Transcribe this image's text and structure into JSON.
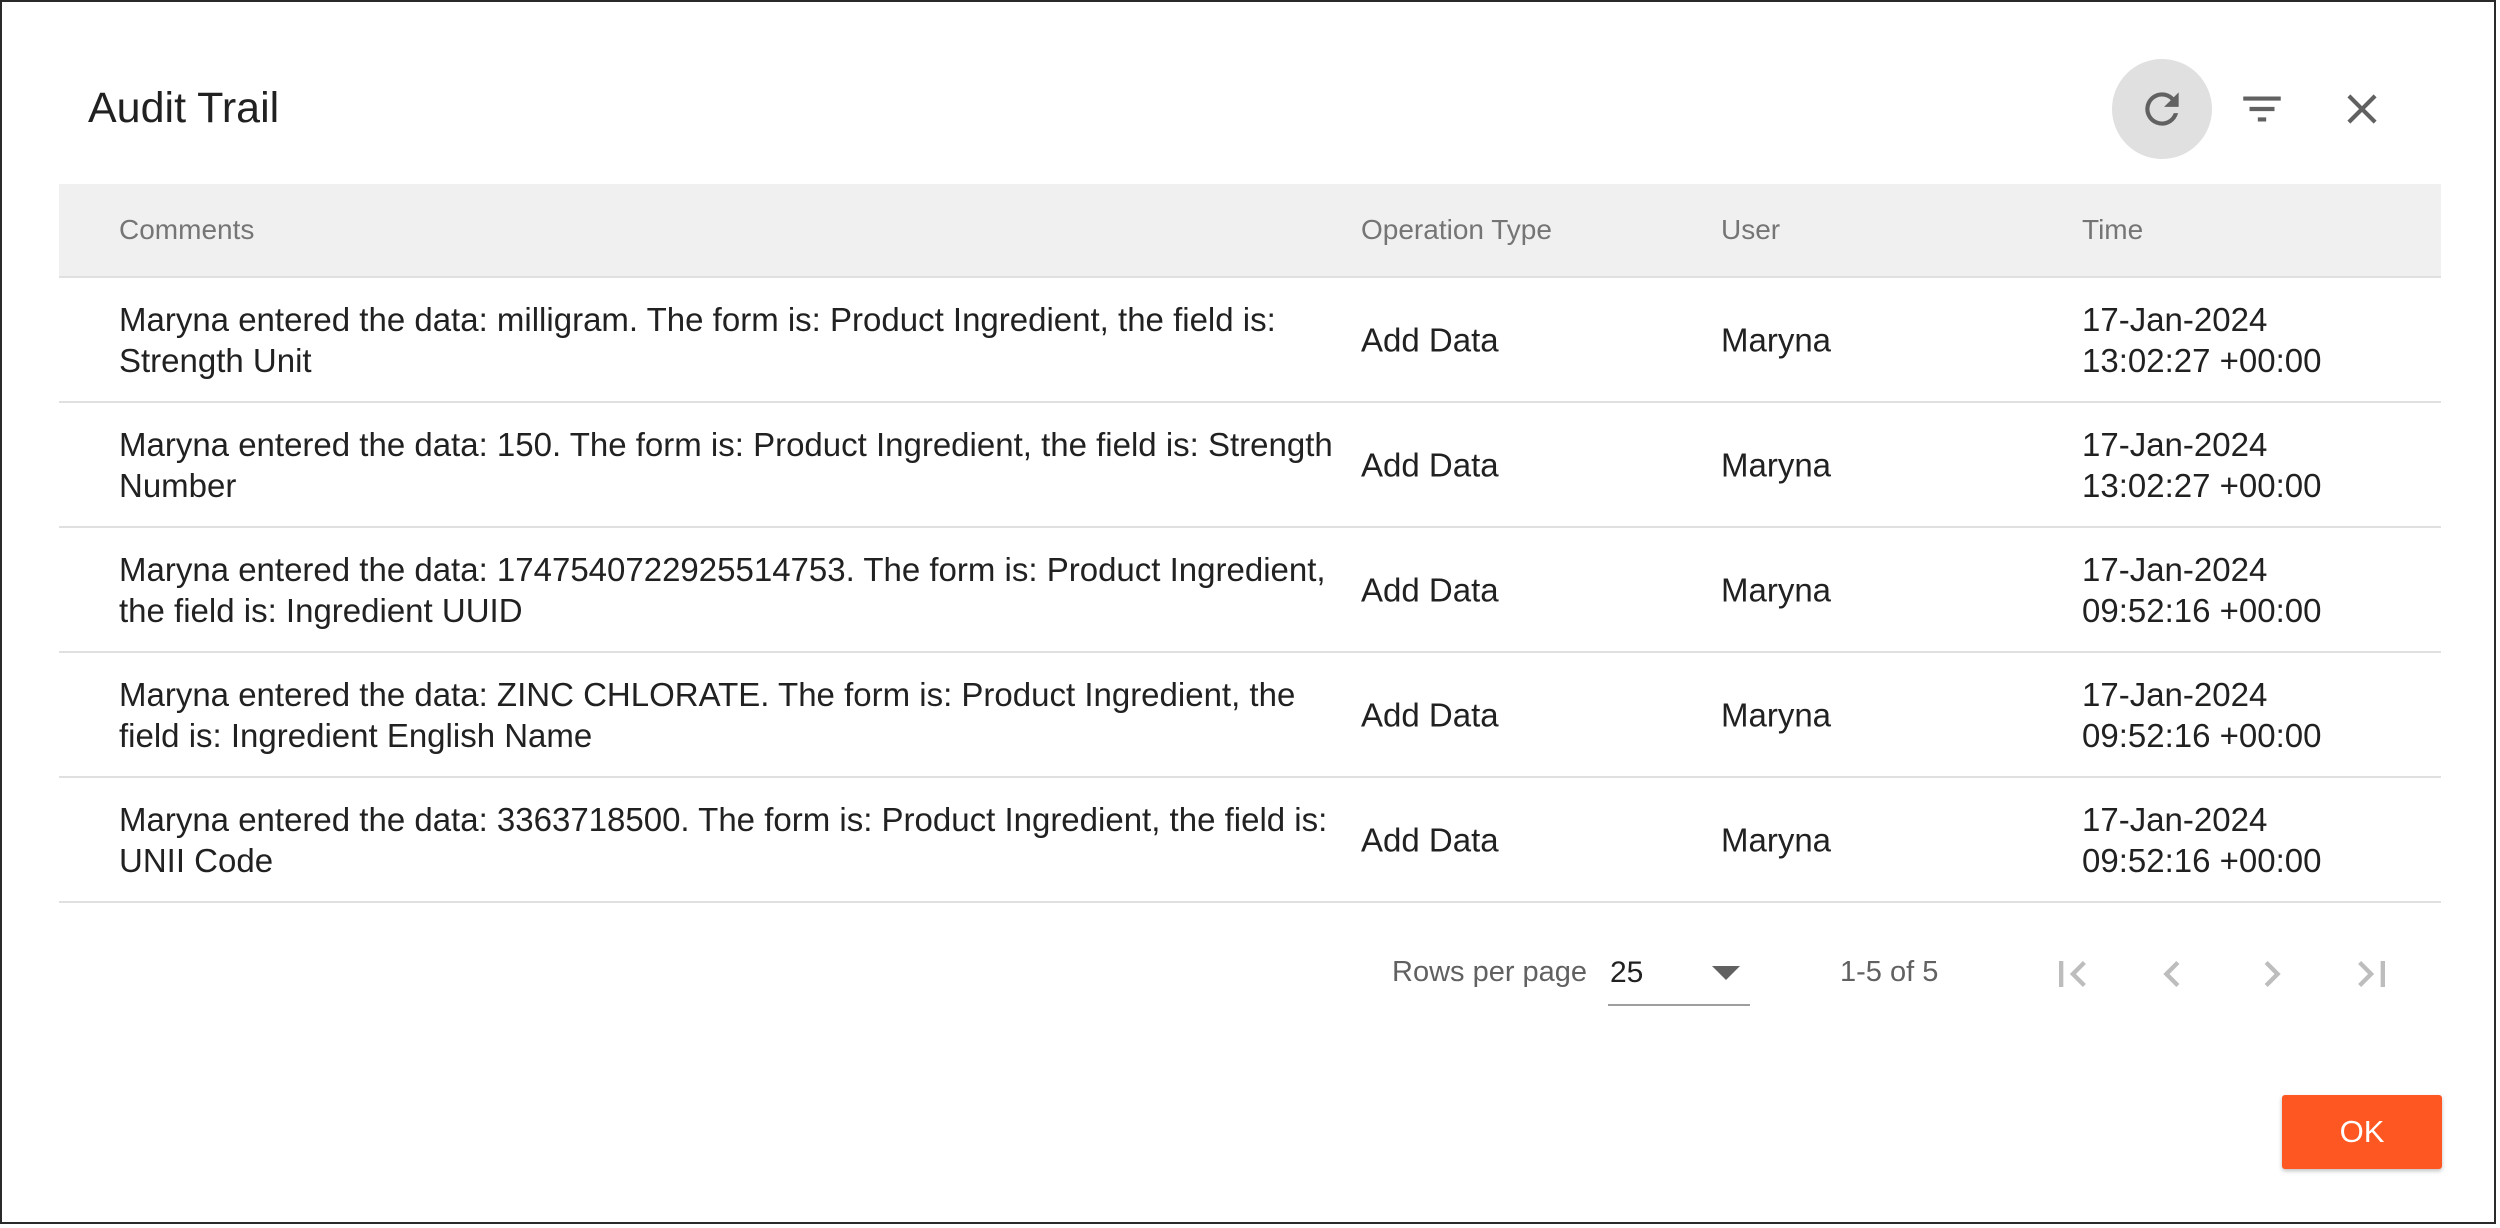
{
  "dialog": {
    "title": "Audit Trail",
    "ok_label": "OK"
  },
  "icons": {
    "refresh": "refresh-icon",
    "filter": "filter-icon",
    "close": "close-icon"
  },
  "table": {
    "headers": {
      "comments": "Comments",
      "operation_type": "Operation Type",
      "user": "User",
      "time": "Time"
    },
    "rows": [
      {
        "comments": "Maryna entered the data: milligram. The form is: Product Ingredient, the field is: Strength Unit",
        "operation_type": "Add Data",
        "user": "Maryna",
        "time_date": "17-Jan-2024",
        "time_clock": "13:02:27 +00:00"
      },
      {
        "comments": "Maryna entered the data: 150. The form is: Product Ingredient, the field is: Strength Number",
        "operation_type": "Add Data",
        "user": "Maryna",
        "time_date": "17-Jan-2024",
        "time_clock": "13:02:27 +00:00"
      },
      {
        "comments": "Maryna entered the data: 1747540722925514753. The form is: Product Ingredient, the field is: Ingredient UUID",
        "operation_type": "Add Data",
        "user": "Maryna",
        "time_date": "17-Jan-2024",
        "time_clock": "09:52:16 +00:00"
      },
      {
        "comments": "Maryna entered the data: ZINC CHLORATE. The form is: Product Ingredient, the field is: Ingredient English Name",
        "operation_type": "Add Data",
        "user": "Maryna",
        "time_date": "17-Jan-2024",
        "time_clock": "09:52:16 +00:00"
      },
      {
        "comments": "Maryna entered the data: 3363718500. The form is: Product Ingredient, the field is: UNII Code",
        "operation_type": "Add Data",
        "user": "Maryna",
        "time_date": "17-Jan-2024",
        "time_clock": "09:52:16 +00:00"
      }
    ]
  },
  "pagination": {
    "rows_per_page_label": "Rows per page",
    "rows_per_page_value": "25",
    "range_text": "1-5 of 5"
  },
  "colors": {
    "accent": "#ff5722",
    "header_bg": "#f0f0f0",
    "refresh_bg": "#e0e0e0"
  }
}
